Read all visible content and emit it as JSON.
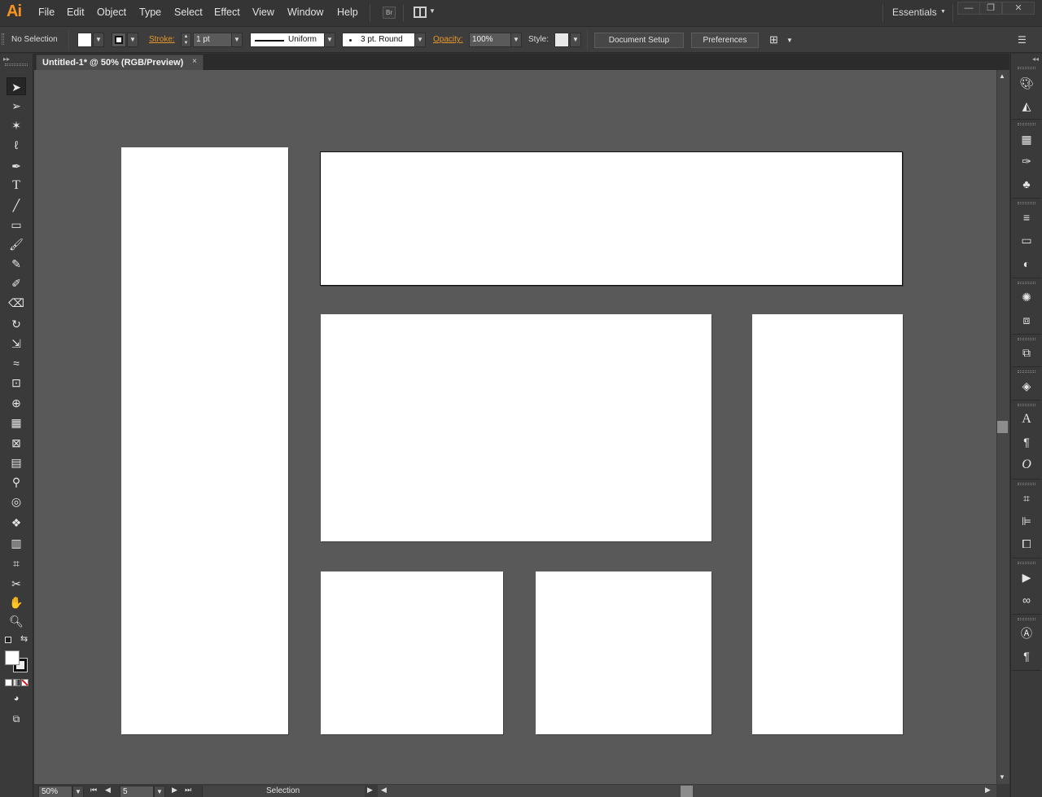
{
  "app": {
    "logo": "Ai",
    "menus": [
      "File",
      "Edit",
      "Object",
      "Type",
      "Select",
      "Effect",
      "View",
      "Window",
      "Help"
    ],
    "bridge_icon": "Br",
    "workspace": "Essentials"
  },
  "control_bar": {
    "selection_label": "No Selection",
    "stroke_label": "Stroke:",
    "stroke_value": "1 pt",
    "profile_value": "Uniform",
    "brush_value": "3 pt. Round",
    "opacity_label": "Opacity:",
    "opacity_value": "100%",
    "style_label": "Style:",
    "document_setup_label": "Document Setup",
    "preferences_label": "Preferences"
  },
  "document": {
    "tab_title": "Untitled-1* @ 50% (RGB/Preview)",
    "tab_close": "×"
  },
  "status_bar": {
    "zoom_value": "50%",
    "artboard_number": "5",
    "tool_status": "Selection"
  },
  "colors": {
    "accent": "#f7931e",
    "canvas": "#595959",
    "artboard": "#ffffff",
    "chrome": "#3a3a3a"
  },
  "tools": [
    "selection-tool-icon",
    "direct-selection-tool-icon",
    "magic-wand-tool-icon",
    "lasso-tool-icon",
    "pen-tool-icon",
    "type-tool-icon",
    "line-segment-tool-icon",
    "rectangle-tool-icon",
    "paintbrush-tool-icon",
    "pencil-tool-icon",
    "blob-brush-tool-icon",
    "eraser-tool-icon",
    "rotate-tool-icon",
    "scale-tool-icon",
    "warp-tool-icon",
    "free-transform-tool-icon",
    "shape-builder-tool-icon",
    "perspective-grid-tool-icon",
    "mesh-tool-icon",
    "gradient-tool-icon",
    "eyedropper-tool-icon",
    "blend-tool-icon",
    "symbol-sprayer-tool-icon",
    "column-graph-tool-icon",
    "artboard-tool-icon",
    "slice-tool-icon",
    "hand-tool-icon",
    "zoom-tool-icon"
  ],
  "panels": [
    "color-panel-icon",
    "color-guide-panel-icon",
    "swatches-panel-icon",
    "brushes-panel-icon",
    "symbols-panel-icon",
    "stroke-panel-icon",
    "gradient-panel-icon",
    "transparency-panel-icon",
    "appearance-panel-icon",
    "graphic-styles-panel-icon",
    "artboards-panel-icon",
    "layers-panel-icon",
    "character-panel-icon",
    "paragraph-panel-icon",
    "opentype-panel-icon",
    "transform-panel-icon",
    "align-panel-icon",
    "pathfinder-panel-icon",
    "actions-panel-icon",
    "links-panel-icon",
    "character-styles-panel-icon",
    "paragraph-styles-panel-icon"
  ]
}
